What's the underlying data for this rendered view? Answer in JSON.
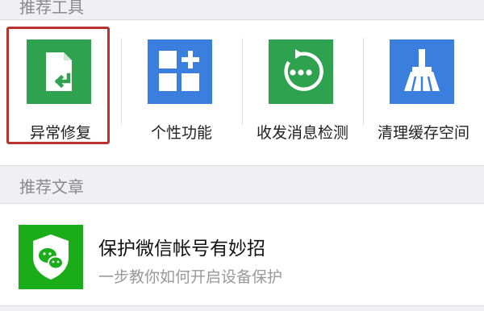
{
  "sections": {
    "recommended_tools": "推荐工具",
    "recommended_articles": "推荐文章"
  },
  "tools": [
    {
      "label": "异常修复",
      "icon": "file-repair-icon",
      "color": "#2fa24f"
    },
    {
      "label": "个性功能",
      "icon": "grid-plus-icon",
      "color": "#3b7fde"
    },
    {
      "label": "收发消息检测",
      "icon": "message-check-icon",
      "color": "#2fa24f"
    },
    {
      "label": "清理缓存空间",
      "icon": "broom-icon",
      "color": "#3b7fde"
    }
  ],
  "highlighted_tool": "异常修复",
  "highlight_color": "#b83232",
  "article": {
    "title": "保护微信帐号有妙招",
    "subtitle": "一步教你如何开启设备保护",
    "icon": "wechat-shield-icon",
    "color": "#1aad19"
  }
}
